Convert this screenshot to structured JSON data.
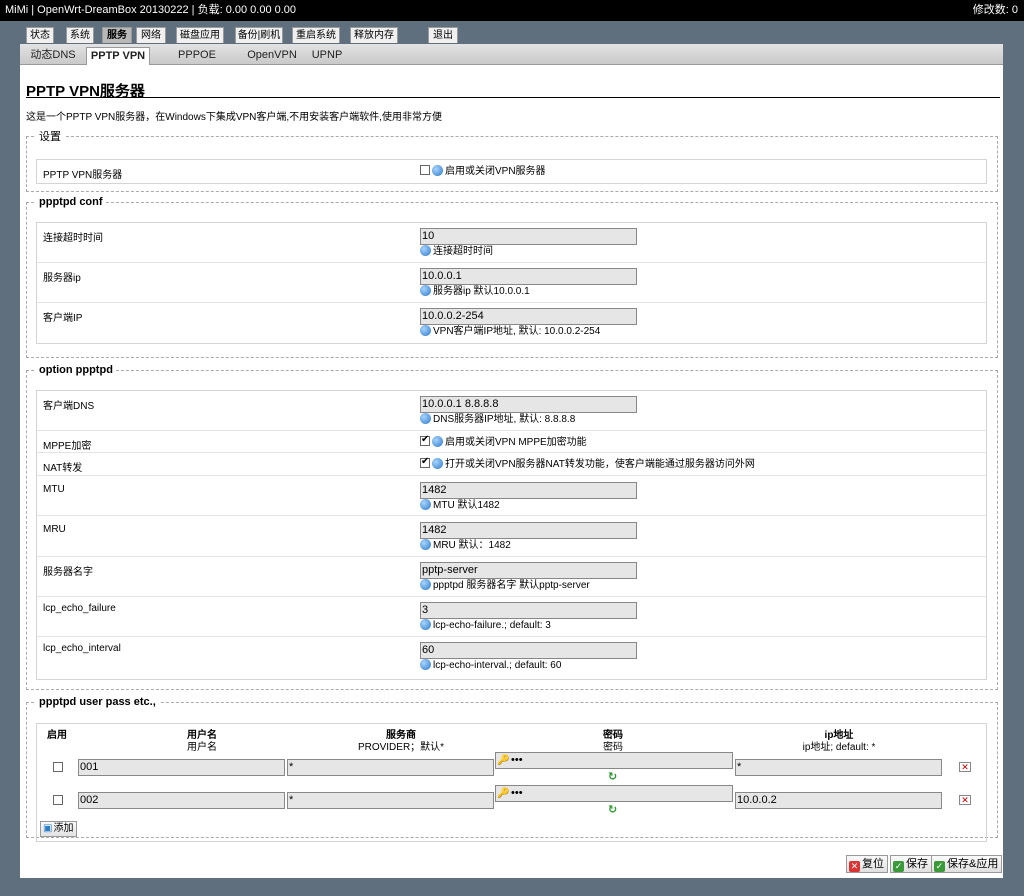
{
  "topbar": {
    "title": "MiMi | OpenWrt-DreamBox 20130222 | 负载: 0.00 0.00 0.00",
    "changes": "修改数: 0"
  },
  "main_tabs": [
    "状态",
    "系统",
    "服务",
    "网络",
    "磁盘应用",
    "备份|刷机",
    "重启系统",
    "释放内存",
    "退出"
  ],
  "sub_tabs": [
    "动态DNS",
    "PPTP VPN",
    "PPPOE SERVER",
    "OpenVPN",
    "UPNP"
  ],
  "page": {
    "title": "PPTP VPN服务器",
    "description": "这是一个PPTP VPN服务器，在Windows下集成VPN客户端,不用安装客户端软件,使用非常方便"
  },
  "settings": {
    "legend": "设置",
    "server_label": "PPTP VPN服务器",
    "server_hint": "启用或关闭VPN服务器",
    "server_enabled": false
  },
  "conf": {
    "legend": "ppptpd conf",
    "rows": [
      {
        "label": "连接超时时间",
        "value": "10",
        "hint": "连接超时时间"
      },
      {
        "label": "服务器ip",
        "value": "10.0.0.1",
        "hint": "服务器ip 默认10.0.0.1"
      },
      {
        "label": "客户端IP",
        "value": "10.0.0.2-254",
        "hint": "VPN客户端IP地址, 默认: 10.0.0.2-254"
      }
    ]
  },
  "option": {
    "legend": "option ppptpd",
    "dns": {
      "label": "客户端DNS",
      "value": "10.0.0.1 8.8.8.8",
      "hint": "DNS服务器IP地址, 默认: 8.8.8.8"
    },
    "mppe": {
      "label": "MPPE加密",
      "hint": "启用或关闭VPN MPPE加密功能",
      "checked": true
    },
    "nat": {
      "label": "NAT转发",
      "hint": "打开或关闭VPN服务器NAT转发功能，使客户端能通过服务器访问外网",
      "checked": true
    },
    "mtu": {
      "label": "MTU",
      "value": "1482",
      "hint": "MTU 默认1482"
    },
    "mru": {
      "label": "MRU",
      "value": "1482",
      "hint": "MRU 默认：1482"
    },
    "name": {
      "label": "服务器名字",
      "value": "pptp-server",
      "hint": "ppptpd 服务器名字 默认pptp-server"
    },
    "echo_failure": {
      "label": "lcp_echo_failure",
      "value": "3",
      "hint": "lcp-echo-failure.; default: 3"
    },
    "echo_interval": {
      "label": "lcp_echo_interval",
      "value": "60",
      "hint": "lcp-echo-interval.; default: 60"
    }
  },
  "users": {
    "legend": "ppptpd user pass etc.,",
    "headers": {
      "enable": "启用",
      "username": "用户名",
      "username_sub": "用户名",
      "provider": "服务商",
      "provider_sub": "PROVIDER；默认*",
      "password": "密码",
      "password_sub": "密码",
      "ip": "ip地址",
      "ip_sub": "ip地址; default: *"
    },
    "rows": [
      {
        "enabled": false,
        "username": "001",
        "provider": "*",
        "password": "•••",
        "ip": "*"
      },
      {
        "enabled": false,
        "username": "002",
        "provider": "*",
        "password": "•••",
        "ip": "10.0.0.2"
      }
    ],
    "add_label": "添加"
  },
  "footer": {
    "reset": "复位",
    "save": "保存",
    "save_apply": "保存&应用"
  }
}
